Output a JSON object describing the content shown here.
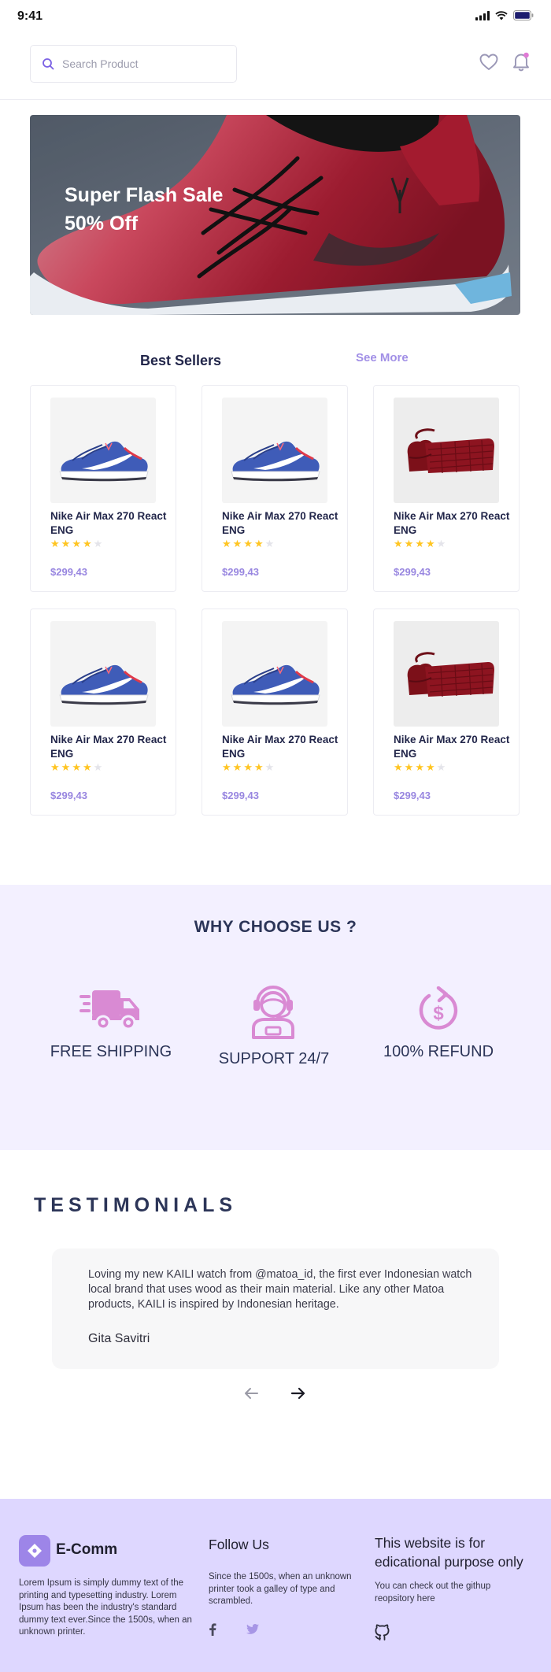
{
  "status": {
    "time": "9:41"
  },
  "search": {
    "placeholder": "Search Product"
  },
  "header": {
    "wishlist_icon": "heart-icon",
    "notification_icon": "bell-icon",
    "notification_dot_color": "#e07ad5"
  },
  "banner": {
    "title_line1": "Super Flash Sale",
    "title_line2": "50% Off"
  },
  "best_sellers": {
    "title": "Best Sellers",
    "see_more": "See More",
    "products": [
      {
        "name": "Nike Air Max 270 React ENG",
        "rating": 4,
        "max_rating": 5,
        "price": "$299,43",
        "image": "blue-sneaker"
      },
      {
        "name": "Nike Air Max 270 React ENG",
        "rating": 4,
        "max_rating": 5,
        "price": "$299,43",
        "image": "blue-sneaker"
      },
      {
        "name": "Nike Air Max 270 React ENG",
        "rating": 4,
        "max_rating": 5,
        "price": "$299,43",
        "image": "red-handbag"
      },
      {
        "name": "Nike Air Max 270 React ENG",
        "rating": 4,
        "max_rating": 5,
        "price": "$299,43",
        "image": "blue-sneaker"
      },
      {
        "name": "Nike Air Max 270 React ENG",
        "rating": 4,
        "max_rating": 5,
        "price": "$299,43",
        "image": "blue-sneaker"
      },
      {
        "name": "Nike Air Max 270 React ENG",
        "rating": 4,
        "max_rating": 5,
        "price": "$299,43",
        "image": "red-handbag"
      }
    ]
  },
  "why_choose": {
    "title": "WHY CHOOSE US ?",
    "features": [
      {
        "label": "FREE SHIPPING",
        "icon": "delivery-truck-icon"
      },
      {
        "label": "SUPPORT 24/7",
        "icon": "support-agent-icon"
      },
      {
        "label": "100% REFUND",
        "icon": "refund-icon"
      }
    ]
  },
  "testimonials": {
    "title": "TESTIMONIALS",
    "quote": "Loving my new KAILI watch from @matoa_id, the first ever Indonesian watch local brand that uses wood as their main material. Like any other Matoa products, KAILI is inspired by Indonesian heritage.",
    "author": "Gita Savitri"
  },
  "footer": {
    "brand": "E-Comm",
    "about": "Lorem Ipsum is simply dummy text of the printing and typesetting industry. Lorem Ipsum has been the industry's standard dummy text ever.Since the 1500s, when an unknown printer.",
    "follow_title": "Follow Us",
    "follow_text": "Since the 1500s, when an unknown printer took a galley of type and scrambled.",
    "notice_title": "This website is for edicational purpose only",
    "notice_text": "You can check out the githup reopsitory here"
  },
  "colors": {
    "accent": "#9d85e8",
    "price": "#9886e0",
    "icon_pink": "#d98ad3",
    "why_bg": "#f3f0ff",
    "footer_bg": "#ded7ff",
    "star": "#ffc522",
    "heading": "#2c3558"
  }
}
